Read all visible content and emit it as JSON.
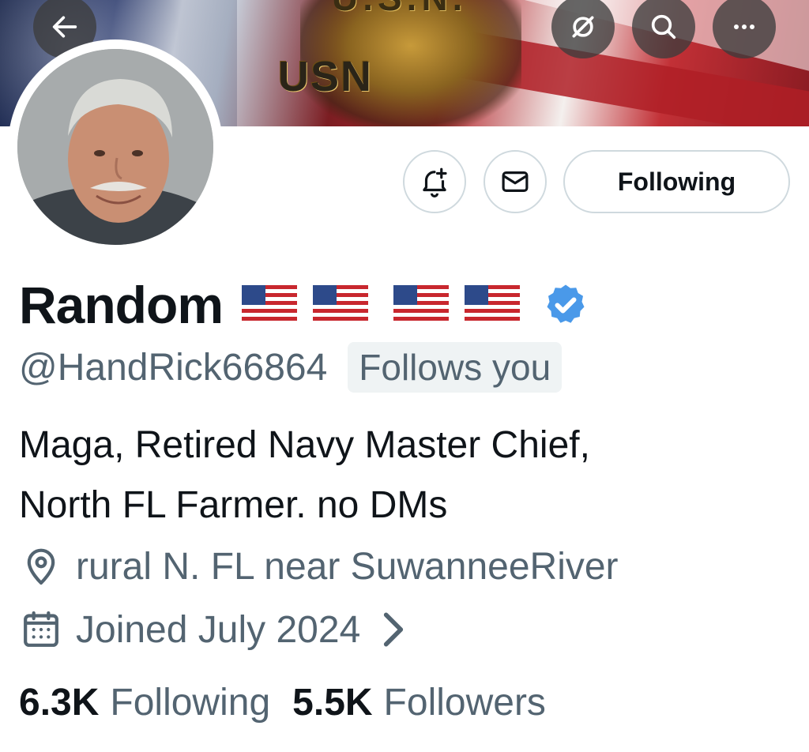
{
  "header": {
    "back_icon": "arrow-left-icon",
    "grok_icon": "grok-icon",
    "search_icon": "search-icon",
    "more_icon": "more-horizontal-icon",
    "banner_text_main": "USN",
    "banner_text_top": "U.S.N."
  },
  "actions": {
    "notify_icon": "bell-plus-icon",
    "message_icon": "envelope-icon",
    "following_label": "Following"
  },
  "profile": {
    "display_name": "Random",
    "flags": [
      "us-flag",
      "us-flag",
      "us-flag",
      "us-flag"
    ],
    "verified_icon": "verified-badge-icon",
    "verified_color": "#4a99e9",
    "handle": "@HandRick66864",
    "follows_you_label": "Follows you",
    "bio_line1": "Maga, Retired Navy Master Chief,",
    "bio_line2": "North FL Farmer. no DMs",
    "location": "rural N. FL near SuwanneeRiver",
    "location_icon": "location-pin-icon",
    "joined": "Joined July 2024",
    "joined_icon": "calendar-icon",
    "joined_chevron": "chevron-right-icon"
  },
  "stats": {
    "following_count": "6.3K",
    "following_label": "Following",
    "followers_count": "5.5K",
    "followers_label": "Followers"
  },
  "colors": {
    "text_primary": "#0f1419",
    "text_secondary": "#536471",
    "border": "#cfd9de",
    "pill_bg": "#eff3f4"
  }
}
